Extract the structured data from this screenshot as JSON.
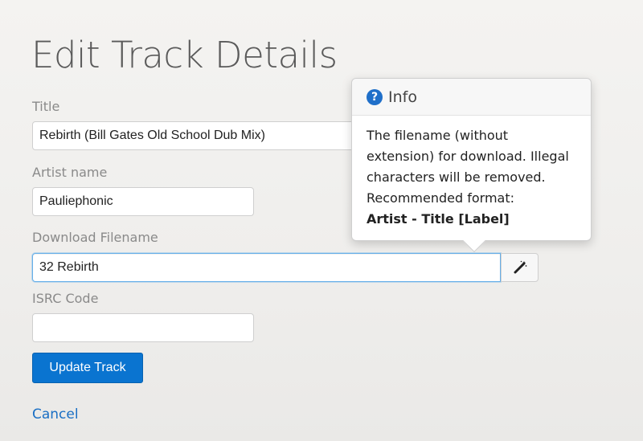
{
  "page": {
    "title": "Edit Track Details"
  },
  "form": {
    "title_label": "Title",
    "title_value": "Rebirth (Bill Gates Old School Dub Mix)",
    "artist_label": "Artist name",
    "artist_value": "Pauliephonic",
    "filename_label": "Download Filename",
    "filename_value": "32 Rebirth",
    "isrc_label": "ISRC Code",
    "isrc_value": "",
    "wand_icon": "magic-wand-icon",
    "update_label": "Update Track",
    "cancel_label": "Cancel"
  },
  "popover": {
    "icon": "question-circle-icon",
    "title": "Info",
    "body": "The filename (without extension) for download. Illegal characters will be removed. Recommended format:",
    "format": "Artist - Title [Label]"
  },
  "colors": {
    "primary": "#0a74d0",
    "link": "#1a6fc4",
    "info_icon": "#1f6fc9",
    "focus_border": "#66afe9"
  }
}
